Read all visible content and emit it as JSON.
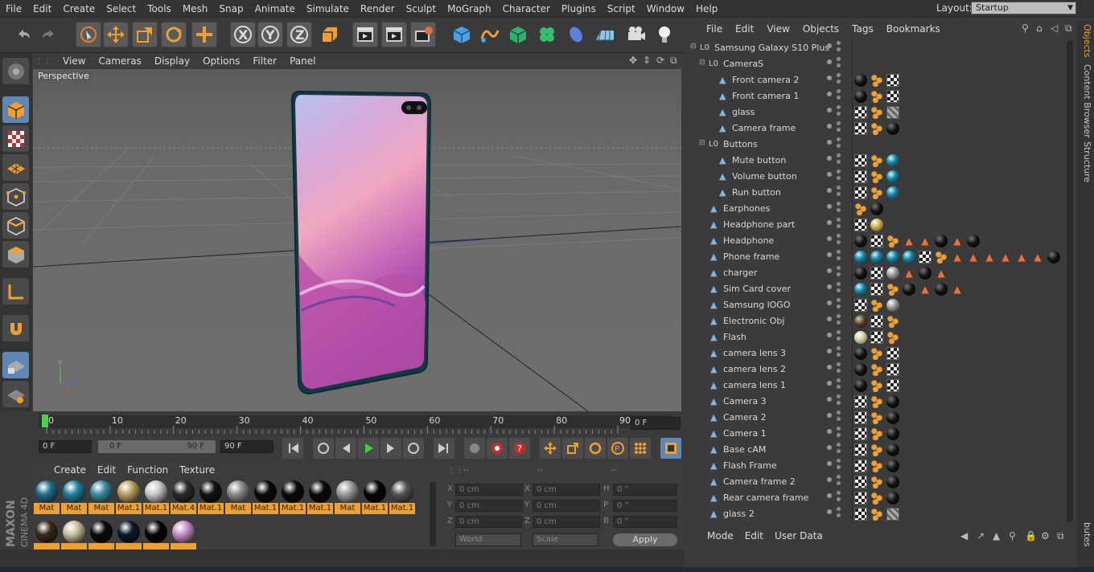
{
  "menubar": {
    "items": [
      "File",
      "Edit",
      "Create",
      "Select",
      "Tools",
      "Mesh",
      "Snap",
      "Animate",
      "Simulate",
      "Render",
      "Sculpt",
      "MoGraph",
      "Character",
      "Plugins",
      "Script",
      "Window",
      "Help"
    ],
    "layout_label": "Layout:",
    "layout_value": "Startup"
  },
  "toolbar": {
    "icons": [
      "undo-icon",
      "redo-icon",
      "live-selection-icon",
      "move-icon",
      "scale-icon",
      "rotate-icon",
      "add-icon",
      "x-axis-icon",
      "y-axis-icon",
      "z-axis-icon",
      "coordinate-system-icon",
      "render-view-icon",
      "render-picture-queue-icon",
      "render-settings-icon",
      "cube-icon",
      "spline-icon",
      "subdivision-icon",
      "mograph-cloner-icon",
      "deformer-icon",
      "floor-icon",
      "camera-icon",
      "light-icon"
    ]
  },
  "lefttools": {
    "icons": [
      "make-editable-icon",
      "model-mode-icon",
      "texture-mode-icon",
      "workplane-icon",
      "points-mode-icon",
      "edges-mode-icon",
      "polygons-mode-icon",
      "axis-icon",
      "magnet-icon",
      "lock-workplane-icon",
      "grid-snap-icon"
    ]
  },
  "viewport": {
    "menu": [
      "View",
      "Cameras",
      "Display",
      "Options",
      "Filter",
      "Panel"
    ],
    "label": "Perspective"
  },
  "timeline": {
    "ticks": [
      "0",
      "10",
      "20",
      "30",
      "40",
      "50",
      "60",
      "70",
      "80",
      "90"
    ],
    "current_frame": "0 F"
  },
  "playbar": {
    "start_frame": "0 F",
    "range_start": "0 F",
    "range_end": "90 F",
    "end_frame": "90 F"
  },
  "materials": {
    "menu": [
      "Create",
      "Edit",
      "Function",
      "Texture"
    ],
    "row1": [
      {
        "label": "Mat",
        "color": "#1f6f8a"
      },
      {
        "label": "Mat",
        "color": "#1f7fa0"
      },
      {
        "label": "Mat",
        "color": "#3a8aa0"
      },
      {
        "label": "Mat.1",
        "color": "#b8a060"
      },
      {
        "label": "Mat.1",
        "color": "#c8c8c8"
      },
      {
        "label": "Mat.4",
        "color": "#2a2a2a"
      },
      {
        "label": "Mat.1",
        "color": "#111111"
      },
      {
        "label": "Mat",
        "color": "#8a8a8a"
      },
      {
        "label": "Mat.1",
        "color": "#0a0a0a"
      },
      {
        "label": "Mat.1",
        "color": "#0a0a0a"
      },
      {
        "label": "Mat.1",
        "color": "#0a0a0a"
      },
      {
        "label": "Mat",
        "color": "#9a9a9a"
      },
      {
        "label": "Mat.1",
        "color": "#050505"
      },
      {
        "label": "Mat.1",
        "color": "#555555"
      }
    ],
    "row2": [
      {
        "label": "",
        "color": "#3a2a1a"
      },
      {
        "label": "",
        "color": "#c8c0a0"
      },
      {
        "label": "",
        "color": "#0a0a0a"
      },
      {
        "label": "",
        "color": "#0a1a2a"
      },
      {
        "label": "",
        "color": "#050505"
      },
      {
        "label": "",
        "color": "#c890c8"
      }
    ]
  },
  "coords": {
    "headers": [
      "--",
      "--",
      "--"
    ],
    "rows": [
      {
        "a": "X",
        "av": "0 cm",
        "b": "X",
        "bv": "0 cm",
        "c": "H",
        "cv": "0 °"
      },
      {
        "a": "Y",
        "av": "0 cm",
        "b": "Y",
        "bv": "0 cm",
        "c": "P",
        "cv": "0 °"
      },
      {
        "a": "Z",
        "av": "0 cm",
        "b": "Z",
        "bv": "0 cm",
        "c": "B",
        "cv": "0 °"
      }
    ],
    "world": "World",
    "scale": "Scale",
    "apply": "Apply"
  },
  "objects": {
    "menu": [
      "File",
      "Edit",
      "View",
      "Objects",
      "Tags",
      "Bookmarks"
    ],
    "rows": [
      {
        "name": "Samsung Galaxy S10 Plus",
        "indent": 0,
        "type": "null",
        "tags": []
      },
      {
        "name": "CameraS",
        "indent": 1,
        "type": "null",
        "tags": []
      },
      {
        "name": "Front camera 2",
        "indent": 2,
        "type": "obj",
        "tags": [
          "sph-black",
          "phong",
          "check"
        ]
      },
      {
        "name": "Front camera 1",
        "indent": 2,
        "type": "obj",
        "tags": [
          "sph-black",
          "phong",
          "check"
        ]
      },
      {
        "name": "glass",
        "indent": 2,
        "type": "obj",
        "tags": [
          "check",
          "phong",
          "stripe"
        ]
      },
      {
        "name": "Camera frame",
        "indent": 2,
        "type": "obj",
        "tags": [
          "check",
          "phong",
          "sph-black"
        ]
      },
      {
        "name": "Buttons",
        "indent": 1,
        "type": "null",
        "tags": []
      },
      {
        "name": "Mute button",
        "indent": 2,
        "type": "obj",
        "tags": [
          "check",
          "phong",
          "sph-teal"
        ]
      },
      {
        "name": "Volume button",
        "indent": 2,
        "type": "obj",
        "tags": [
          "check",
          "phong",
          "sph-teal"
        ]
      },
      {
        "name": "Run button",
        "indent": 2,
        "type": "obj",
        "tags": [
          "check",
          "phong",
          "sph-teal"
        ]
      },
      {
        "name": "Earphones",
        "indent": 1,
        "type": "obj",
        "tags": [
          "phong",
          "sph-black"
        ]
      },
      {
        "name": "Headphone part",
        "indent": 1,
        "type": "obj",
        "tags": [
          "check",
          "sph-gold"
        ]
      },
      {
        "name": "Headphone",
        "indent": 1,
        "type": "obj",
        "tags": [
          "sph-black",
          "check",
          "phong",
          "tri",
          "tri",
          "sph-black",
          "tri",
          "sph-black"
        ]
      },
      {
        "name": "Phone frame",
        "indent": 1,
        "type": "obj",
        "tags": [
          "sph-teal",
          "sph-teal",
          "sph-teal",
          "sph-teal",
          "check",
          "phong",
          "tri",
          "tri",
          "tri",
          "tri",
          "tri",
          "tri",
          "sph-black",
          "tri"
        ]
      },
      {
        "name": "charger",
        "indent": 1,
        "type": "obj",
        "tags": [
          "sph-black",
          "check",
          "sph-grey",
          "tri",
          "sph-black",
          "tri"
        ]
      },
      {
        "name": "Sim Card cover",
        "indent": 1,
        "type": "obj",
        "tags": [
          "sph-teal",
          "check",
          "phong",
          "sph-black",
          "tri",
          "sph-black",
          "tri"
        ]
      },
      {
        "name": "Samsung lOGO",
        "indent": 1,
        "type": "obj",
        "tags": [
          "check",
          "phong",
          "sph-grey"
        ]
      },
      {
        "name": "Electronic Obj",
        "indent": 1,
        "type": "obj",
        "tags": [
          "sph-brown",
          "check",
          "phong"
        ]
      },
      {
        "name": "Flash",
        "indent": 1,
        "type": "obj",
        "tags": [
          "sph-cream",
          "check",
          "phong"
        ]
      },
      {
        "name": "camera lens 3",
        "indent": 1,
        "type": "obj",
        "tags": [
          "sph-black",
          "phong",
          "check"
        ]
      },
      {
        "name": "camera lens 2",
        "indent": 1,
        "type": "obj",
        "tags": [
          "sph-black",
          "phong",
          "check"
        ]
      },
      {
        "name": "camera lens 1",
        "indent": 1,
        "type": "obj",
        "tags": [
          "sph-black",
          "phong",
          "check"
        ]
      },
      {
        "name": "Camera 3",
        "indent": 1,
        "type": "obj",
        "tags": [
          "check",
          "phong",
          "sph-black"
        ]
      },
      {
        "name": "Camera 2",
        "indent": 1,
        "type": "obj",
        "tags": [
          "check",
          "phong",
          "sph-black"
        ]
      },
      {
        "name": "Camera 1",
        "indent": 1,
        "type": "obj",
        "tags": [
          "check",
          "phong",
          "sph-black"
        ]
      },
      {
        "name": "Base cAM",
        "indent": 1,
        "type": "obj",
        "tags": [
          "check",
          "phong",
          "sph-black"
        ]
      },
      {
        "name": "Flash Frame",
        "indent": 1,
        "type": "obj",
        "tags": [
          "check",
          "phong",
          "sph-black"
        ]
      },
      {
        "name": "Camera frame 2",
        "indent": 1,
        "type": "obj",
        "tags": [
          "check",
          "phong",
          "sph-black"
        ]
      },
      {
        "name": "Rear camera frame",
        "indent": 1,
        "type": "obj",
        "tags": [
          "check",
          "phong",
          "sph-black"
        ]
      },
      {
        "name": "glass 2",
        "indent": 1,
        "type": "obj",
        "tags": [
          "check",
          "phong",
          "stripe"
        ]
      }
    ]
  },
  "attributes": {
    "menu": [
      "Mode",
      "Edit",
      "User Data"
    ]
  },
  "right_tabs": [
    "Objects",
    "Content Browser",
    "Structure",
    "butes"
  ],
  "brand": {
    "line1": "MAXON",
    "line2": "CINEMA 4D"
  },
  "colors": {
    "accent": "#5f87b5",
    "material_label": "#f0a030",
    "phone_gradient_top": "#a8b8f0",
    "phone_gradient_bottom": "#b040a0"
  }
}
